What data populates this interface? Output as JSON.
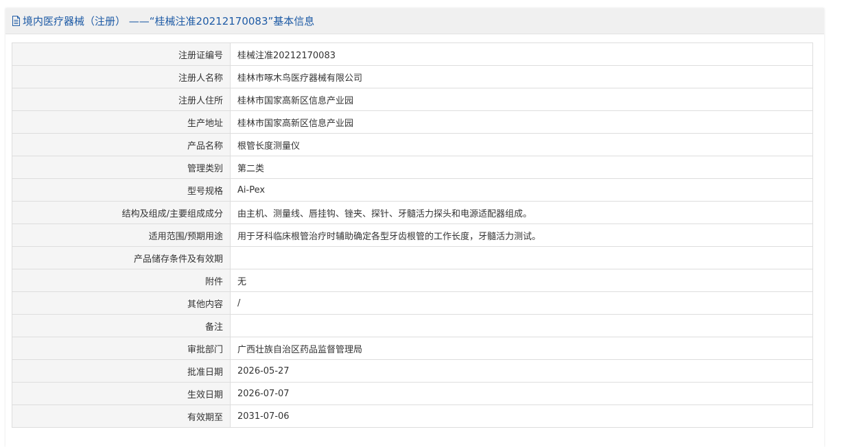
{
  "header": {
    "icon": "document-icon",
    "title": "境内医疗器械（注册） ——“桂械注准20212170083”基本信息",
    "color": "#1d5aa5"
  },
  "rows": [
    {
      "label": "注册证编号",
      "value": "桂械注准20212170083"
    },
    {
      "label": "注册人名称",
      "value": "桂林市啄木鸟医疗器械有限公司"
    },
    {
      "label": "注册人住所",
      "value": "桂林市国家高新区信息产业园"
    },
    {
      "label": "生产地址",
      "value": "桂林市国家高新区信息产业园"
    },
    {
      "label": "产品名称",
      "value": "根管长度测量仪"
    },
    {
      "label": "管理类别",
      "value": "第二类"
    },
    {
      "label": "型号规格",
      "value": "Ai-Pex"
    },
    {
      "label": "结构及组成/主要组成成分",
      "value": "由主机、测量线、唇挂钩、锉夹、探针、牙髓活力探头和电源适配器组成。"
    },
    {
      "label": "适用范围/预期用途",
      "value": "用于牙科临床根管治疗时辅助确定各型牙齿根管的工作长度，牙髓活力测试。"
    },
    {
      "label": "产品储存条件及有效期",
      "value": ""
    },
    {
      "label": "附件",
      "value": "无"
    },
    {
      "label": "其他内容",
      "value": "/"
    },
    {
      "label": "备注",
      "value": ""
    },
    {
      "label": "审批部门",
      "value": "广西壮族自治区药品监督管理局"
    },
    {
      "label": "批准日期",
      "value": "2026-05-27"
    },
    {
      "label": "生效日期",
      "value": "2026-07-07"
    },
    {
      "label": "有效期至",
      "value": "2031-07-06"
    }
  ]
}
